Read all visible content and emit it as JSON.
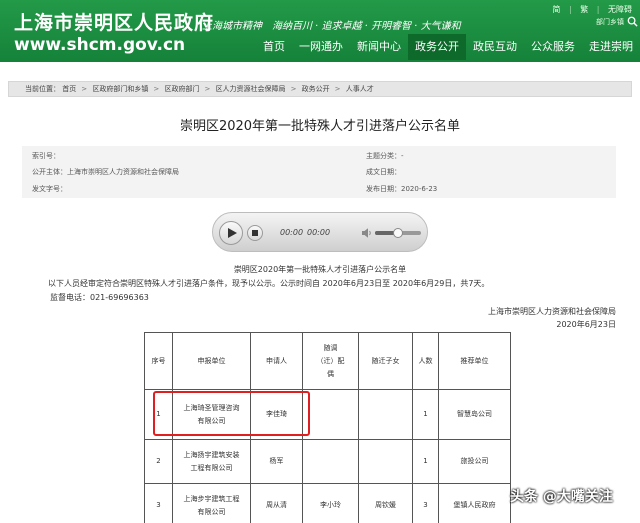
{
  "header": {
    "site_name": "上海市崇明区人民政府",
    "site_url": "www.shcm.gov.cn",
    "slogan": "上海城市精神　海纳百川 · 追求卓越 · 开明睿智 · 大气谦和",
    "lang": [
      "简",
      "繁",
      "无障碍"
    ],
    "town_link": "部门乡镇"
  },
  "nav": {
    "items": [
      "首页",
      "一网通办",
      "新闻中心",
      "政务公开",
      "政民互动",
      "公众服务",
      "走进崇明"
    ],
    "active": "政务公开"
  },
  "breadcrumb": {
    "prefix": "当前位置：",
    "items": [
      "首页",
      "区政府部门和乡镇",
      "区政府部门",
      "区人力资源社会保障局",
      "政务公开",
      "人事人才"
    ],
    "sep": ">"
  },
  "title": "崇明区2020年第一批特殊人才引进落户公示名单",
  "meta": {
    "index_label": "索引号：",
    "index_value": "",
    "publisher_label": "公开主体：",
    "publisher_value": "上海市崇明区人力资源和社会保障局",
    "doc_label": "发文字号：",
    "doc_value": "",
    "category_label": "主题分类：",
    "category_value": "-",
    "created_label": "成文日期：",
    "created_value": "",
    "pub_label": "发布日期：",
    "pub_value": "2020-6-23"
  },
  "player": {
    "current": "00:00",
    "total": "00:00",
    "volume": 0.5
  },
  "notice": {
    "title": "崇明区2020年第一批特殊人才引进落户公示名单",
    "body": "以下人员经审定符合崇明区特殊人才引进落户条件，现予以公示。公示时间自 2020年6月23日至 2020年6月29日，共7天。",
    "phone": "监督电话：021-69696363",
    "org": "上海市崇明区人力资源和社会保障局",
    "date": "2020年6月23日"
  },
  "table": {
    "headers": {
      "no": "序号",
      "unit": "申报单位",
      "applicant": "申请人",
      "spouse_1": "随调",
      "spouse_2": "（迁）配",
      "spouse_3": "偶",
      "child": "随迁子女",
      "count": "人数",
      "recommender": "推荐单位"
    },
    "rows": [
      {
        "no": "1",
        "unit_1": "上海琦圣管理咨询",
        "unit_2": "有限公司",
        "applicant": "李佳琦",
        "spouse": "",
        "child": "",
        "count": "1",
        "recommender": "智慧岛公司"
      },
      {
        "no": "2",
        "unit_1": "上海扬宇建筑安装",
        "unit_2": "工程有限公司",
        "applicant": "杨军",
        "spouse": "",
        "child": "",
        "count": "1",
        "recommender": "旅投公司"
      },
      {
        "no": "3",
        "unit_1": "上海步宇建筑工程",
        "unit_2": "有限公司",
        "applicant": "周从清",
        "spouse": "李小玲",
        "child": "周钦媛",
        "count": "3",
        "recommender": "堡镇人民政府"
      }
    ]
  },
  "watermark": "头条 @大嘴关注"
}
